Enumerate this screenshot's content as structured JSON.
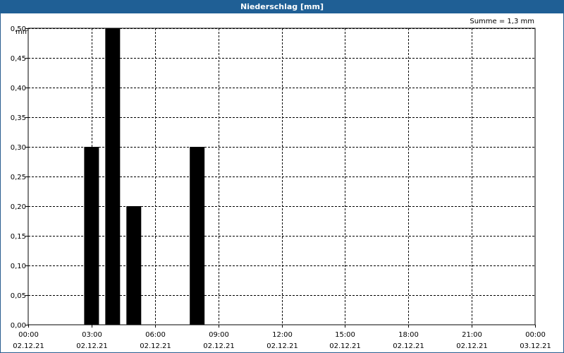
{
  "title": "Niederschlag [mm]",
  "sum_label": "Summe = 1,3 mm",
  "unit_label": "mm",
  "colors": {
    "titlebar": "#1f5f95",
    "bars": "#000000",
    "grid": "#000000"
  },
  "chart_data": {
    "type": "bar",
    "title": "Niederschlag [mm]",
    "ylabel": "mm",
    "ylim": [
      0,
      0.5
    ],
    "xlim": [
      "02.12.21 00:00",
      "03.12.21 00:00"
    ],
    "grid": true,
    "y_ticks": [
      "0,00",
      "0,05",
      "0,10",
      "0,15",
      "0,20",
      "0,25",
      "0,30",
      "0,35",
      "0,40",
      "0,45",
      "0,50"
    ],
    "x_ticks": [
      {
        "time": "00:00",
        "date": "02.12.21"
      },
      {
        "time": "03:00",
        "date": "02.12.21"
      },
      {
        "time": "06:00",
        "date": "02.12.21"
      },
      {
        "time": "09:00",
        "date": "02.12.21"
      },
      {
        "time": "12:00",
        "date": "02.12.21"
      },
      {
        "time": "15:00",
        "date": "02.12.21"
      },
      {
        "time": "18:00",
        "date": "02.12.21"
      },
      {
        "time": "21:00",
        "date": "02.12.21"
      },
      {
        "time": "00:00",
        "date": "03.12.21"
      }
    ],
    "bars": [
      {
        "x": "02.12.21 03:00",
        "value": 0.3
      },
      {
        "x": "02.12.21 04:00",
        "value": 0.5
      },
      {
        "x": "02.12.21 05:00",
        "value": 0.2
      },
      {
        "x": "02.12.21 08:00",
        "value": 0.3
      }
    ]
  }
}
